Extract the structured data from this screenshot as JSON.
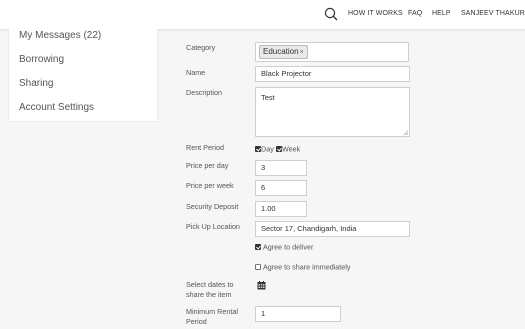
{
  "header": {
    "nav": [
      "HOW IT WORKS",
      "FAQ",
      "HELP"
    ],
    "user": "SANJEEV THAKUR",
    "user_menu_icon": "chevron-down-icon",
    "search_icon": "search-icon"
  },
  "sidebar": {
    "items": [
      "My Messages (22)",
      "Borrowing",
      "Sharing",
      "Account Settings"
    ]
  },
  "form": {
    "category": {
      "label": "Category",
      "tags": [
        "Education"
      ],
      "remove_glyph": "×"
    },
    "name": {
      "label": "Name",
      "value": "Black Projector"
    },
    "description": {
      "label": "Description",
      "value": "Test"
    },
    "rent_period": {
      "label": "Rent Period",
      "options": [
        {
          "label": "Day",
          "checked": true
        },
        {
          "label": "Week",
          "checked": true
        }
      ]
    },
    "price_per_day": {
      "label": "Price per day",
      "value": "3"
    },
    "price_per_week": {
      "label": "Price per week",
      "value": "6"
    },
    "security_deposit": {
      "label": "Security Deposit",
      "value": "1.00"
    },
    "pickup_location": {
      "label": "Pick Up Location",
      "value": "Sector 17, Chandigarh, India"
    },
    "agree_deliver": {
      "label": "Agree to deliver",
      "checked": true
    },
    "agree_share": {
      "label": "Agree to share immediately",
      "checked": false
    },
    "select_dates": {
      "label": "Select dates to share the item",
      "icon": "calendar-icon"
    },
    "minimum_rental_period": {
      "label": "Minimum Rental Period",
      "value": "1"
    }
  }
}
